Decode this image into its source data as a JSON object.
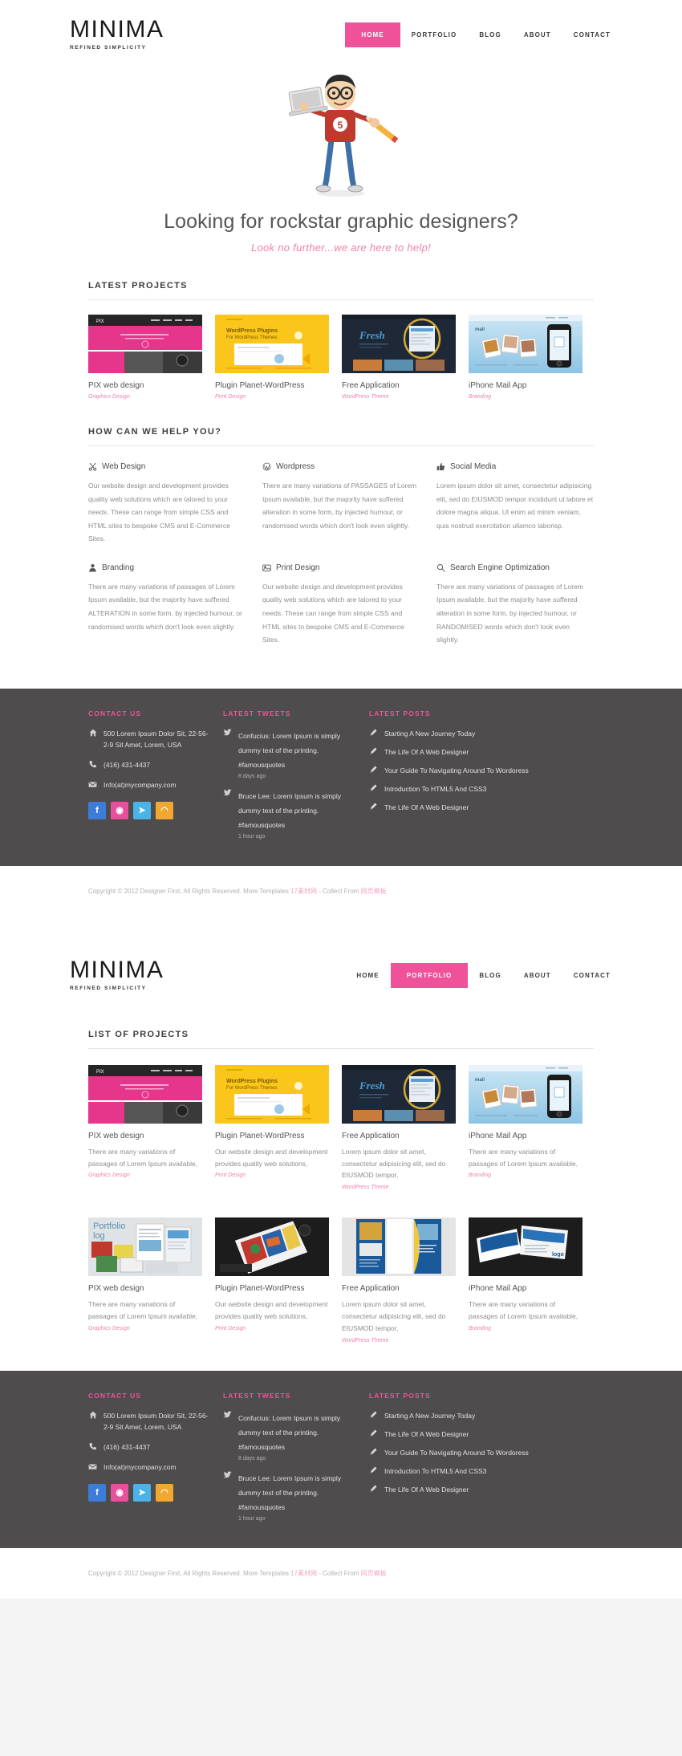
{
  "brand": {
    "name": "MINIMA",
    "tagline": "REFINED SIMPLICITY"
  },
  "colors": {
    "accent": "#f0529a",
    "accent_soft": "#ef7fae",
    "footer_bg": "#4e4c4c",
    "text": "#555555"
  },
  "nav": {
    "home": "HOME",
    "portfolio": "PORTFOLIO",
    "blog": "BLOG",
    "about": "ABOUT",
    "contact": "CONTACT"
  },
  "hero": {
    "title": "Looking for rockstar graphic designers?",
    "subtitle": "Look no further...we are here to help!"
  },
  "sections": {
    "latest_projects": "LATEST PROJECTS",
    "how_can_we_help": "HOW CAN WE HELP YOU?",
    "list_of_projects": "LIST OF PROJECTS"
  },
  "latest_projects": [
    {
      "title": "PIX web design",
      "category": "Graphics Design"
    },
    {
      "title": "Plugin Planet-WordPress",
      "category": "Print Design"
    },
    {
      "title": "Free Application",
      "category": "WordPress Theme"
    },
    {
      "title": "iPhone Mail App",
      "category": "Branding"
    }
  ],
  "services": [
    {
      "icon": "scissors-icon",
      "title": "Web Design",
      "body": "Our website design and development provides quality web solutions which are talored to your needs. These can range from simple CSS and HTML sites to bespoke CMS and E-Commerce Sites."
    },
    {
      "icon": "wordpress-icon",
      "title": "Wordpress",
      "body": "There are many variations of PASSAGES of Lorem Ipsum available, but the majority have suffered alteration in some form, by injected humour, or randomised words which don't look even slightly."
    },
    {
      "icon": "thumbs-up-icon",
      "title": "Social Media",
      "body": "Lorem ipsum dolor sit amet, consectetur adipisicing elit, sed do EIUSMOD tempor incididunt ut labore et dolore magna aliqua. Ut enim ad minim veniam, quis nostrud exercitation ullamco laborisp."
    },
    {
      "icon": "user-icon",
      "title": "Branding",
      "body": "There are many variations of passages of Lorem Ipsum available, but the majority have suffered ALTERATION in some form, by injected humour, or randomised words which don't look even slightly."
    },
    {
      "icon": "image-icon",
      "title": "Print Design",
      "body": "Our website design and development provides quality web solutions which are talored to your needs. These can range from simple CSS and HTML sites to bespoke CMS and E-Commerce Sites."
    },
    {
      "icon": "magnifier-icon",
      "title": "Search Engine Optimization",
      "body": "There are many variations of passages of Lorem Ipsum available, but the majority have suffered alteration in some form, by injected humour, or RANDOMISED words which don't look even slightly."
    }
  ],
  "portfolio_row1": [
    {
      "title": "PIX web design",
      "desc": "There are many variations of passages of Lorem Ipsum available,",
      "category": "Graphics Design"
    },
    {
      "title": "Plugin Planet-WordPress",
      "desc": "Our website design and development provides quality web solutions,",
      "category": "Print Design"
    },
    {
      "title": "Free Application",
      "desc": "Lorem ipsum dolor sit amet, consectetur adipisicing elit, sed do EIUSMOD tempor,",
      "category": "WordPress Theme"
    },
    {
      "title": "iPhone Mail App",
      "desc": "There are many variations of passages of Lorem Ipsum available,",
      "category": "Branding"
    }
  ],
  "portfolio_row2": [
    {
      "title": "PIX web design",
      "desc": "There are many variations of passages of Lorem Ipsum available,",
      "category": "Graphics Design"
    },
    {
      "title": "Plugin Planet-WordPress",
      "desc": "Our website design and development provides quality web solutions,",
      "category": "Print Design"
    },
    {
      "title": "Free Application",
      "desc": "Lorem ipsum dolor sit amet, consectetur adipisicing elit, sed do EIUSMOD tempor,",
      "category": "WordPress Theme"
    },
    {
      "title": "iPhone Mail App",
      "desc": "There are many variations of passages of Lorem Ipsum available,",
      "category": "Branding"
    }
  ],
  "footer": {
    "contact_title": "CONTACT US",
    "address": "500 Lorem Ipsum Dolor Sit, 22-56-2-9 Sit Amet, Lorem, USA",
    "phone": "(416) 431-4437",
    "email": "Info(at)mycompany.com",
    "social": [
      {
        "name": "facebook-icon",
        "glyph": "f",
        "color": "#3b7dd8"
      },
      {
        "name": "dribbble-icon",
        "glyph": "◉",
        "color": "#e84f9c"
      },
      {
        "name": "twitter-icon",
        "glyph": "➤",
        "color": "#4ab3e8"
      },
      {
        "name": "rss-icon",
        "glyph": "◠",
        "color": "#f0a830"
      }
    ],
    "tweets_title": "LATEST TWEETS",
    "tweets": [
      {
        "text": "Confucius: Lorem Ipsum is simply dummy text of the printing. #famousquotes",
        "time": "8 days ago"
      },
      {
        "text": "Bruce Lee: Lorem Ipsum is simply dummy text of the printing. #famousquotes",
        "time": "1 hour ago"
      }
    ],
    "posts_title": "LATEST POSTS",
    "posts": [
      "Starting A New Journey Today",
      "The Life Of A Web Designer",
      "Your Guide To Navigating Around To Wordoress",
      "Introduction To HTML5 And CSS3",
      "The Life Of A Web Designer"
    ],
    "copyright_pre": "Copyright © 2012 Designer First, All Rights Reserved. More Templates ",
    "copyright_cn1": "17素材网",
    "copyright_mid": " - Collect From ",
    "copyright_cn2": "网页模板"
  }
}
